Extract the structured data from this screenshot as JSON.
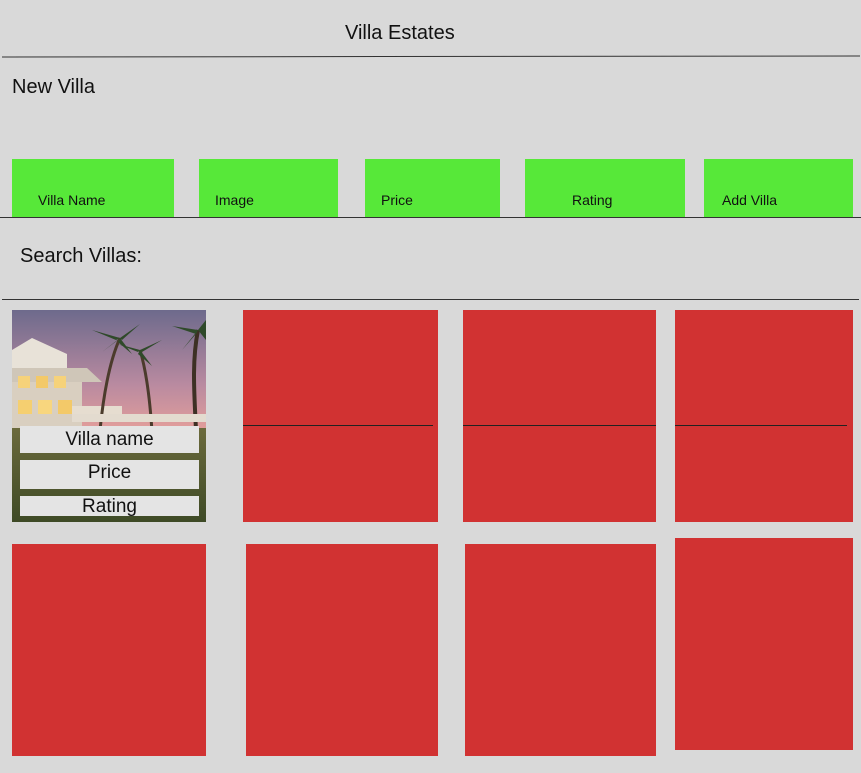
{
  "header": {
    "title": "Villa Estates"
  },
  "form": {
    "section_title": "New Villa",
    "fields": {
      "villa_name": "Villa Name",
      "image": "Image",
      "price": "Price",
      "rating": "Rating",
      "add_villa": "Add Villa"
    }
  },
  "search": {
    "label": "Search Villas:"
  },
  "card": {
    "name_label": "Villa name",
    "price_label": "Price",
    "rating_label": "Rating"
  },
  "colors": {
    "background": "#d9d9d9",
    "field_green": "#57e839",
    "card_red": "#d13232"
  }
}
